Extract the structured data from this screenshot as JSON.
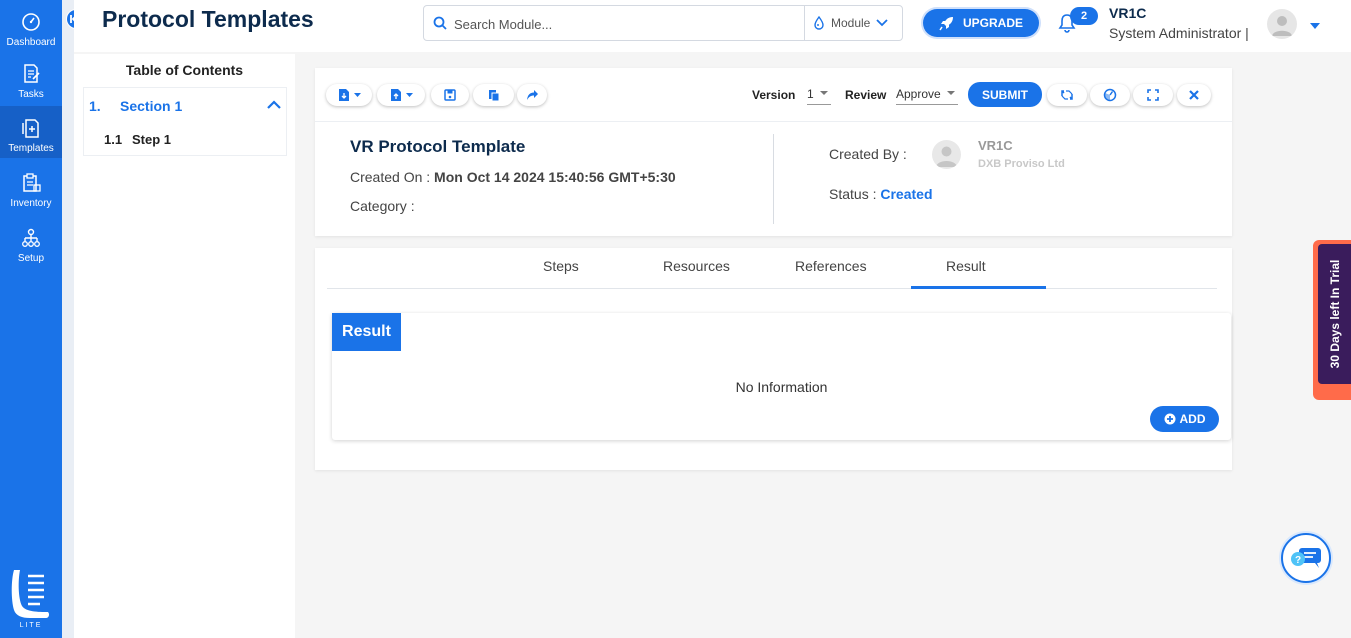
{
  "nav": {
    "items": [
      {
        "label": "Dashboard",
        "icon": "dashboard-icon"
      },
      {
        "label": "Tasks",
        "icon": "tasks-icon"
      },
      {
        "label": "Templates",
        "icon": "templates-icon"
      },
      {
        "label": "Inventory",
        "icon": "inventory-icon"
      },
      {
        "label": "Setup",
        "icon": "setup-icon"
      }
    ],
    "active": "Templates",
    "logo_text": "LITE"
  },
  "header": {
    "title": "Protocol Templates",
    "search_placeholder": "Search Module...",
    "module_label": "Module",
    "upgrade_label": "UPGRADE",
    "notification_count": "2",
    "user_name": "VR1C",
    "user_role": "System Administrator |"
  },
  "toc": {
    "title": "Table of Contents",
    "section_num": "1.",
    "section_label": "Section 1",
    "step_num": "1.1",
    "step_label": "Step 1"
  },
  "toolbar": {
    "version_label": "Version",
    "version_value": "1",
    "review_label": "Review",
    "review_value": "Approve",
    "submit_label": "SUBMIT"
  },
  "template": {
    "name": "VR Protocol Template",
    "created_on_label": "Created On :",
    "created_on_value": "Mon Oct 14 2024 15:40:56 GMT+5:30",
    "category_label": "Category :",
    "created_by_label": "Created By :",
    "created_by_name": "VR1C",
    "created_by_org": "DXB Proviso Ltd",
    "status_label": "Status :",
    "status_value": "Created"
  },
  "tabs": {
    "items": [
      "Steps",
      "Resources",
      "References",
      "Result"
    ],
    "active": "Result"
  },
  "result": {
    "title": "Result",
    "empty_text": "No Information",
    "add_label": "ADD"
  },
  "trial": {
    "text": "30 Days left In Trial"
  },
  "colors": {
    "primary": "#1a73e8",
    "title": "#0d2b4d",
    "trial_outer": "#ff6b4a",
    "trial_inner": "#3a1c5c"
  }
}
